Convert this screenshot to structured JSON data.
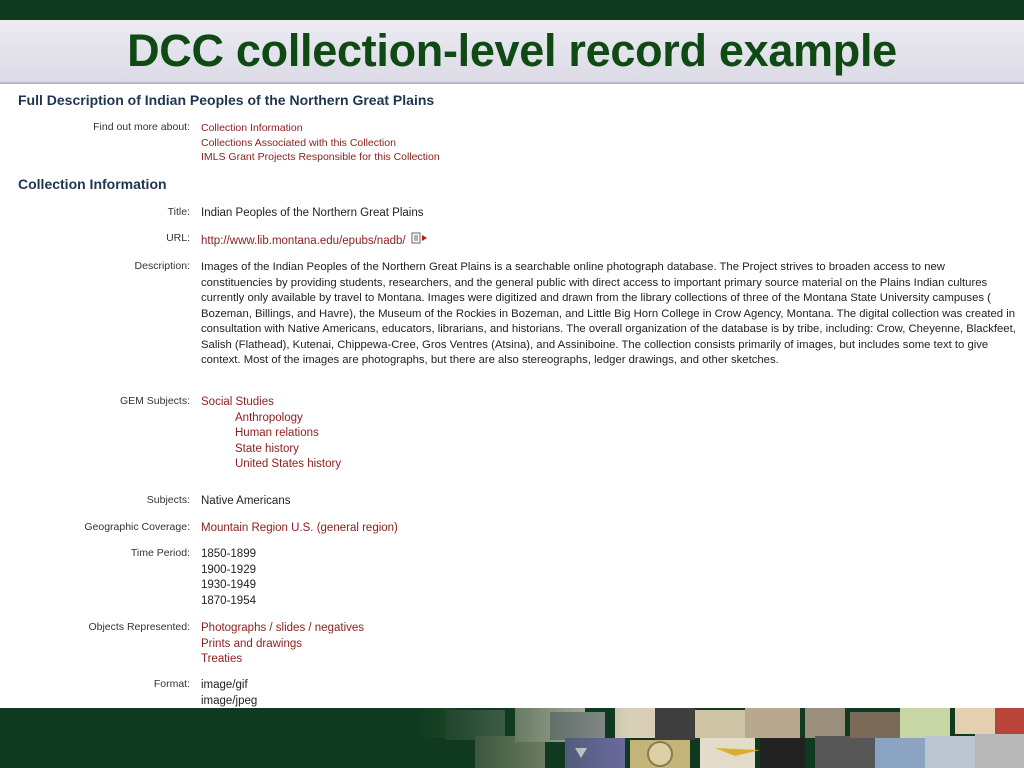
{
  "slide": {
    "title": "DCC collection-level record example"
  },
  "record": {
    "heading_full": "Full Description of Indian Peoples of the Northern Great Plains",
    "find_out_label": "Find out more about:",
    "find_out_links": [
      "Collection Information",
      "Collections Associated with this Collection",
      "IMLS Grant Projects Responsible for this Collection"
    ],
    "heading_collection": "Collection Information",
    "title_label": "Title:",
    "title_value": "Indian Peoples of the Northern Great Plains",
    "url_label": "URL:",
    "url_value": "http://www.lib.montana.edu/epubs/nadb/",
    "description_label": "Description:",
    "description_value": "Images of the Indian Peoples of the Northern Great Plains is a searchable online photograph database. The Project strives to broaden access to new constituencies by providing students, researchers, and the general public with direct access to important primary source material on the Plains Indian cultures currently only available by travel to Montana. Images were digitized and drawn from the library collections of three of the Montana State University campuses ( Bozeman, Billings, and Havre), the Museum of the Rockies in Bozeman, and Little Big Horn College in Crow Agency, Montana. The digital collection was created in consultation with Native Americans, educators, librarians, and historians. The overall organization of the database is by tribe, including: Crow, Cheyenne, Blackfeet, Salish (Flathead), Kutenai, Chippewa-Cree, Gros Ventres (Atsina), and Assiniboine. The collection consists primarily of images, but includes some text to give context. Most of the images are photographs, but there are also stereographs, ledger drawings, and other sketches.",
    "gem_label": "GEM Subjects:",
    "gem_main": "Social Studies",
    "gem_subs": [
      "Anthropology",
      "Human relations",
      "State history",
      "United States history"
    ],
    "subjects_label": "Subjects:",
    "subjects_value": "Native Americans",
    "geo_label": "Geographic Coverage:",
    "geo_value": "Mountain Region U.S. (general region)",
    "time_label": "Time Period:",
    "time_values": [
      "1850-1899",
      "1900-1929",
      "1930-1949",
      "1870-1954"
    ],
    "objects_label": "Objects Represented:",
    "objects_values": [
      "Photographs / slides / negatives",
      "Prints and drawings",
      "Treaties"
    ],
    "format_label": "Format:",
    "format_values": [
      "image/gif",
      "image/jpeg"
    ]
  },
  "colors": {
    "title_green": "#0f4a14",
    "link_red": "#8b1d1d",
    "heading_blue": "#1e3552",
    "band_green": "#103a1f"
  },
  "icons": {
    "url_external": "external-link-icon"
  }
}
